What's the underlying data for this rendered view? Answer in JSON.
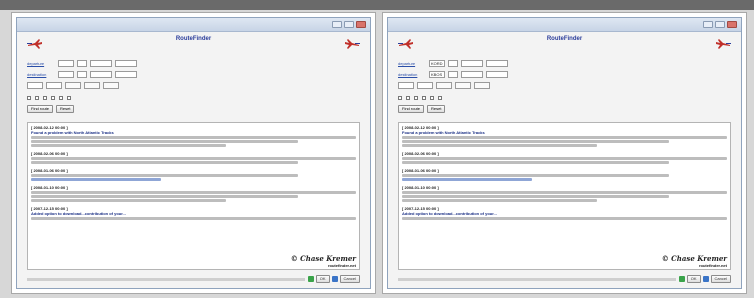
{
  "window_title": "",
  "app": {
    "name": "RouteFinder",
    "subtitle": ""
  },
  "form": {
    "departure_label": "departure",
    "destination_label": "destination",
    "right": {
      "departure_value": "KORD",
      "destination_value": "KBOS"
    }
  },
  "options_labels": [
    "",
    "",
    "",
    "",
    "",
    ""
  ],
  "buttons": {
    "find": "Find route",
    "reset": "Reset",
    "ok": "OK",
    "cancel": "Cancel"
  },
  "log_entries": [
    {
      "date": "[ 2008-02-12 00:00 ]",
      "head": "Found a problem with North Atlantic Tracks"
    },
    {
      "date": "[ 2008-02-06 00:00 ]",
      "head": ""
    },
    {
      "date": "[ 2008-01-06 00:00 ]",
      "head": ""
    },
    {
      "date": "[ 2008-01-10 00:00 ]",
      "head": ""
    },
    {
      "date": "[ 2007-12-15 00:00 ]",
      "head": "Added option to download...contribution of your..."
    }
  ],
  "watermark": {
    "main": "© Chase Kremer",
    "small": "routefinder.net"
  },
  "colors": {
    "accent": "#2a3c9a",
    "link": "#2a4ea8",
    "titlebar": "#c7d4e6"
  }
}
